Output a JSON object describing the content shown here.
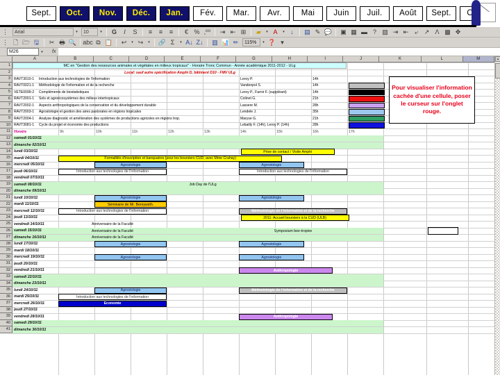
{
  "month_tabs": [
    {
      "label": "Sept.",
      "active": false
    },
    {
      "label": "Oct.",
      "active": true
    },
    {
      "label": "Nov.",
      "active": true
    },
    {
      "label": "Déc.",
      "active": true
    },
    {
      "label": "Jan.",
      "active": true
    },
    {
      "label": "Fév.",
      "active": false
    },
    {
      "label": "Mar.",
      "active": false
    },
    {
      "label": "Avr.",
      "active": false
    },
    {
      "label": "Mai",
      "active": false
    },
    {
      "label": "Juin",
      "active": false
    },
    {
      "label": "Juil.",
      "active": false
    },
    {
      "label": "Août",
      "active": false
    },
    {
      "label": "Sept.",
      "active": false
    },
    {
      "label": "Oct.",
      "active": false
    }
  ],
  "toolbar": {
    "font_name": "Arial",
    "font_size": "10",
    "zoom": "115%",
    "bold": "G",
    "italic": "I",
    "underline": "S",
    "currency": "€",
    "percent": "%",
    "euro_icon": "€"
  },
  "formula_bar": {
    "namebox": "M26",
    "fx": "fx",
    "value": ""
  },
  "sheet": {
    "col_headers": [
      "A",
      "B",
      "C",
      "D",
      "E",
      "F",
      "G",
      "H",
      "I",
      "J",
      "K",
      "L",
      "M"
    ],
    "selected_col": "M",
    "row_numbers": [
      1,
      2,
      3,
      4,
      5,
      6,
      7,
      8,
      9,
      10,
      11,
      12,
      13,
      14,
      15,
      16,
      17,
      18,
      19,
      20,
      21,
      22,
      23,
      24,
      25,
      26,
      27,
      28,
      29,
      30,
      31,
      32,
      33,
      34,
      35,
      36,
      37,
      38,
      39,
      40,
      41
    ],
    "title": "MC en \"Gestion des ressources animales et végétales en milieux tropicaux\" - Horaire Tronc Commun - Année académique 2011-2012 - ULg",
    "subtitle": "Local: sauf autre spécification Amphi D, bâtiment D10 - FMV ULg",
    "courses": [
      {
        "code": "RAVT3010-1",
        "name": "Introduction aux technologies de l'information",
        "teacher": "Leroy P.",
        "hours": "14h"
      },
      {
        "code": "RAVT0021-1",
        "name": "Méthodologie de l'information et de la recherche",
        "teacher": "Vandenpol S.",
        "hours": "14h"
      },
      {
        "code": "VETE0099-2",
        "name": "Compléments de biostatistiques",
        "teacher": "Leroy P., Farnir F. (suppléant)",
        "hours": "14h"
      },
      {
        "code": "RAVT2001-1",
        "name": "Sols et agroécosystèmes des milieux intertropicaux",
        "teacher": "Colinet G.",
        "hours": "21h"
      },
      {
        "code": "RAVT2002-1",
        "name": "Aspects anthropologiques de la conservation et du développement durable",
        "teacher": "Lassere M.",
        "hours": "28h"
      },
      {
        "code": "RAVT2003-1",
        "name": "Agrostologie et gestion des aires pastorales en régions tropicales",
        "teacher": "Lendele J.",
        "hours": "35h"
      },
      {
        "code": "RAVT2004-1",
        "name": "Analyse diagnostic et amélioration des systèmes de productions agricoles en régions trop.",
        "teacher": "Maryse G.",
        "hours": "21h"
      },
      {
        "code": "RAVT3081-1",
        "name": "Cycle du projet et économie des productions",
        "teacher": "Lebailly F. (14h), Leroy P. (14h)",
        "hours": "28h"
      }
    ],
    "legend_colors": [
      "#bfbfbf",
      "#000000",
      "#ee1111",
      "#c9a0ee",
      "#9dc8ee",
      "#2e9e63",
      "#1111dd"
    ],
    "time_header_label": "Horaire",
    "time_slots": [
      "9h",
      "10h",
      "11h",
      "12h",
      "13h",
      "14h",
      "15h",
      "16h",
      "17h"
    ],
    "notice": "Pour visualiser l'information cachée d'une cellule, poser le curseur sur l'onglet rouge.",
    "notice_color": "#e8001c",
    "days": [
      {
        "row": 12,
        "date": "samedi 01/10/11",
        "weekend": true,
        "events": []
      },
      {
        "row": 13,
        "date": "dimanche 02/10/11",
        "weekend": true,
        "events": []
      },
      {
        "row": 14,
        "date": "lundi 03/10/11",
        "weekend": false,
        "events": [
          {
            "label": "Prise de contact / Visite Amphi",
            "style": "hatch",
            "start": 5.05,
            "span": 2.6
          }
        ]
      },
      {
        "row": 15,
        "date": "mardi 04/10/11",
        "weekend": false,
        "events": [
          {
            "label": "Formalités d'inscription et banquaires (pour les boursiers CUD, avec Mme Crahay)",
            "style": "yellow",
            "start": 0.0,
            "span": 6.2
          }
        ]
      },
      {
        "row": 16,
        "date": "mercredi 05/10/11",
        "weekend": false,
        "events": [
          {
            "label": "Agrostologie",
            "style": "blue",
            "start": 1.0,
            "span": 2.0
          },
          {
            "label": "Agrostologie",
            "style": "blue",
            "start": 5.0,
            "span": 1.8
          }
        ]
      },
      {
        "row": 17,
        "date": "jeudi 06/10/11",
        "weekend": false,
        "events": [
          {
            "label": "Introduction aux technologies de l'information",
            "style": "white",
            "start": 0.0,
            "span": 3.0
          },
          {
            "label": "Introduction aux technologies de l'information",
            "style": "white",
            "start": 5.0,
            "span": 3.0
          }
        ]
      },
      {
        "row": 18,
        "date": "vendredi 07/10/11",
        "weekend": false,
        "events": []
      },
      {
        "row": 19,
        "date": "samedi 08/10/11",
        "weekend": true,
        "events": [
          {
            "label": "Job Day de l'ULg",
            "style": "green",
            "start": 0.0,
            "span": 8.0
          }
        ]
      },
      {
        "row": 20,
        "date": "dimanche 09/10/11",
        "weekend": true,
        "events": []
      },
      {
        "row": 21,
        "date": "lundi 10/10/11",
        "weekend": false,
        "events": [
          {
            "label": "Agrostologie",
            "style": "blue",
            "start": 1.0,
            "span": 2.0
          },
          {
            "label": "Agrostologie",
            "style": "blue",
            "start": 5.0,
            "span": 1.8
          }
        ]
      },
      {
        "row": 22,
        "date": "mardi 11/10/11",
        "weekend": false,
        "events": [
          {
            "label": "Séminaire de Mr. Bereywsth.",
            "style": "orange",
            "start": 1.0,
            "span": 2.0
          }
        ]
      },
      {
        "row": 23,
        "date": "mercredi 12/10/11",
        "weekend": false,
        "events": [
          {
            "label": "Introduction aux technologies de l'information",
            "style": "white",
            "start": 0.0,
            "span": 3.0
          },
          {
            "label": "Méthodologie de l'information et de la recherche",
            "style": "gray",
            "start": 5.0,
            "span": 3.0
          }
        ]
      },
      {
        "row": 24,
        "date": "jeudi 13/10/11",
        "weekend": false,
        "events": [
          {
            "label": "2011: Accueil boursiers à la CUD (ULB)",
            "style": "yellow",
            "start": 5.05,
            "span": 3.0
          }
        ]
      },
      {
        "row": 25,
        "date": "vendredi 14/10/11",
        "weekend": false,
        "events": [
          {
            "label": "Anniversaire de la Faculté",
            "style": "plain",
            "start": 0.0,
            "span": 3.0
          }
        ]
      },
      {
        "row": 26,
        "date": "samedi 15/10/11",
        "weekend": true,
        "events": [
          {
            "label": "Anniversaire de la Faculté",
            "style": "green",
            "start": 0.0,
            "span": 3.0
          },
          {
            "label": "Symposium bee-tropive",
            "style": "green",
            "start": 5.0,
            "span": 3.0
          }
        ]
      },
      {
        "row": 27,
        "date": "dimanche 16/10/11",
        "weekend": true,
        "events": [
          {
            "label": "Anniversaire de la Faculté",
            "style": "green",
            "start": 0.0,
            "span": 3.0
          }
        ]
      },
      {
        "row": 28,
        "date": "lundi 17/10/11",
        "weekend": false,
        "events": [
          {
            "label": "Agrostologie",
            "style": "blue",
            "start": 1.0,
            "span": 2.0
          },
          {
            "label": "Agrostologie",
            "style": "blue",
            "start": 5.0,
            "span": 1.8
          }
        ]
      },
      {
        "row": 29,
        "date": "mardi 18/10/11",
        "weekend": false,
        "events": []
      },
      {
        "row": 30,
        "date": "mercredi 19/10/11",
        "weekend": false,
        "events": [
          {
            "label": "Agrostologie",
            "style": "blue",
            "start": 1.0,
            "span": 2.0
          },
          {
            "label": "Agrostologie",
            "style": "blue",
            "start": 5.0,
            "span": 1.8
          }
        ]
      },
      {
        "row": 31,
        "date": "jeudi 20/10/11",
        "weekend": false,
        "events": []
      },
      {
        "row": 32,
        "date": "vendredi 21/10/11",
        "weekend": false,
        "events": [
          {
            "label": "Anthropologie",
            "style": "purple",
            "start": 5.0,
            "span": 2.6
          }
        ]
      },
      {
        "row": 33,
        "date": "samedi 22/10/11",
        "weekend": true,
        "events": []
      },
      {
        "row": 34,
        "date": "dimanche 23/10/11",
        "weekend": true,
        "events": []
      },
      {
        "row": 35,
        "date": "lundi 24/10/11",
        "weekend": false,
        "events": [
          {
            "label": "Agrostologie",
            "style": "blue",
            "start": 1.0,
            "span": 2.0
          },
          {
            "label": "Méthodologie de l'information et de la recherche",
            "style": "gray",
            "start": 5.0,
            "span": 3.0
          }
        ]
      },
      {
        "row": 36,
        "date": "mardi 25/10/11",
        "weekend": false,
        "events": [
          {
            "label": "Introduction aux technologies de l'information",
            "style": "white",
            "start": 0.0,
            "span": 3.0
          }
        ]
      },
      {
        "row": 37,
        "date": "mercredi 26/10/11",
        "weekend": false,
        "events": [
          {
            "label": "Economie",
            "style": "dblue",
            "start": 0.0,
            "span": 3.0
          }
        ]
      },
      {
        "row": 38,
        "date": "jeudi 27/10/11",
        "weekend": false,
        "events": []
      },
      {
        "row": 39,
        "date": "vendredi 28/10/11",
        "weekend": false,
        "events": [
          {
            "label": "Anthropologie",
            "style": "purple",
            "start": 5.0,
            "span": 2.6
          }
        ]
      },
      {
        "row": 40,
        "date": "samedi 29/10/11",
        "weekend": true,
        "events": []
      },
      {
        "row": 41,
        "date": "dimanche 30/10/11",
        "weekend": true,
        "events": []
      }
    ]
  }
}
